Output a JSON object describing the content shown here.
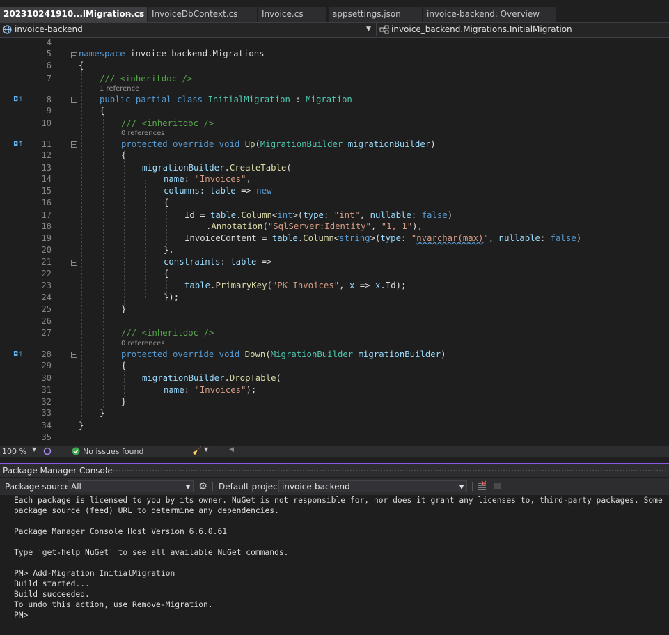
{
  "tabs": [
    {
      "label": "202310241910...lMigration.cs",
      "active": true
    },
    {
      "label": "InvoiceDbContext.cs"
    },
    {
      "label": "Invoice.cs"
    },
    {
      "label": "appsettings.json"
    },
    {
      "label": "invoice-backend: Overview"
    }
  ],
  "tab_actions": {
    "pin": "⊸",
    "close": "✕"
  },
  "navbar": {
    "project": "invoice-backend",
    "member": "invoice_backend.Migrations.InitialMigration"
  },
  "editor": {
    "line_numbers": [
      "4",
      "5",
      "6",
      "7",
      "8",
      "9",
      "10",
      "11",
      "12",
      "13",
      "14",
      "15",
      "16",
      "17",
      "18",
      "19",
      "20",
      "21",
      "22",
      "23",
      "24",
      "25",
      "26",
      "27",
      "28",
      "29",
      "30",
      "31",
      "32",
      "33",
      "34",
      "35"
    ],
    "codelens": {
      "class_refs": "1 reference",
      "up_refs": "0 references",
      "down_refs": "0 references"
    },
    "override_glyph": "◘↑",
    "code": {
      "l5": {
        "kw": "namespace",
        "rest": " invoice_backend.Migrations"
      },
      "l6": "{",
      "l7": "/// <inheritdoc />",
      "l8": {
        "kw": "public partial class",
        "name": "InitialMigration",
        "sep": " : ",
        "base": "Migration"
      },
      "l9": "{",
      "l10": "/// <inheritdoc />",
      "l11": {
        "kw": "protected override void",
        "fn": "Up",
        "open": "(",
        "type": "MigrationBuilder",
        "param": "migrationBuilder",
        "close": ")"
      },
      "l12": "{",
      "l13": {
        "obj": "migrationBuilder",
        "dot": ".",
        "fn": "CreateTable",
        "open": "("
      },
      "l14": {
        "arg": "name",
        "colon": ": ",
        "str": "\"Invoices\"",
        "end": ","
      },
      "l15": {
        "arg": "columns",
        "colon": ": ",
        "p": "table",
        "arrow": " => ",
        "kw": "new"
      },
      "l16": "{",
      "l17": {
        "a": "Id = ",
        "p": "table",
        "b": ".",
        "fn": "Column",
        "lt": "<",
        "t": "int",
        "gt": ">(",
        "a1": "type",
        "c1": ": ",
        "s1": "\"int\"",
        "comma": ", ",
        "a2": "nullable",
        "c2": ": ",
        "v": "false",
        "end": ")"
      },
      "l18": {
        "dot": ".",
        "fn": "Annotation",
        "open": "(",
        "s1": "\"SqlServer:Identity\"",
        "comma": ", ",
        "s2": "\"1, 1\"",
        "end": "),"
      },
      "l19": {
        "a": "InvoiceContent = ",
        "p": "table",
        "b": ".",
        "fn": "Column",
        "lt": "<",
        "t": "string",
        "gt": ">(",
        "a1": "type",
        "c1": ": ",
        "s1a": "\"",
        "s1b": "nvarchar(max)",
        "s1c": "\"",
        "comma": ", ",
        "a2": "nullable",
        "c2": ": ",
        "v": "false",
        "end": ")"
      },
      "l20": "},",
      "l21": {
        "arg": "constraints",
        "colon": ": ",
        "p": "table",
        "arrow": " =>"
      },
      "l22": "{",
      "l23": {
        "p": "table",
        "dot": ".",
        "fn": "PrimaryKey",
        "open": "(",
        "str": "\"PK_Invoices\"",
        "comma": ", ",
        "x1": "x",
        "arrow": " => ",
        "x2": "x",
        "end": ".Id);"
      },
      "l24": "});",
      "l25": "}",
      "l27": "/// <inheritdoc />",
      "l28": {
        "kw": "protected override void",
        "fn": "Down",
        "open": "(",
        "type": "MigrationBuilder",
        "param": "migrationBuilder",
        "close": ")"
      },
      "l29": "{",
      "l30": {
        "obj": "migrationBuilder",
        "dot": ".",
        "fn": "DropTable",
        "open": "("
      },
      "l31": {
        "arg": "name",
        "colon": ": ",
        "str": "\"Invoices\"",
        "end": ");"
      },
      "l32": "}",
      "l33": "}",
      "l34": "}"
    }
  },
  "editor_status": {
    "zoom": "100 %",
    "issues": "No issues found"
  },
  "pmc": {
    "title": "Package Manager Console",
    "source_label": "Package source:",
    "source_value": "All",
    "project_label": "Default project:",
    "project_value": "invoice-backend",
    "lines": [
      "Each package is licensed to you by its owner. NuGet is not responsible for, nor does it grant any licenses to, third-party packages. Some",
      "package source (feed) URL to determine any dependencies.",
      "",
      "Package Manager Console Host Version 6.6.0.61",
      "",
      "Type 'get-help NuGet' to see all available NuGet commands.",
      "",
      "PM> Add-Migration InitialMigration",
      "Build started...",
      "Build succeeded.",
      "To undo this action, use Remove-Migration."
    ],
    "prompt": "PM> "
  },
  "colors": {
    "keyword": "#569cd6",
    "type": "#4ec9b0",
    "string": "#d69d85",
    "comment": "#57a64a",
    "method": "#dcdcaa",
    "param": "#9cdcfe",
    "accent": "#8957e5"
  }
}
